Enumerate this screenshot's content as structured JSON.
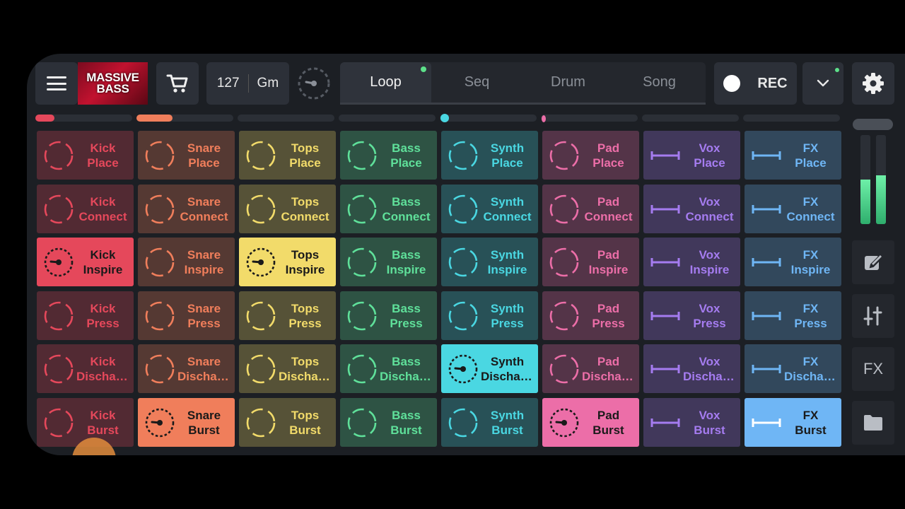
{
  "header": {
    "pack_title_line1": "MASSIVE",
    "pack_title_line2": "BASS",
    "tempo": "127",
    "key": "Gm",
    "tabs": [
      {
        "label": "Loop",
        "active": true
      },
      {
        "label": "Seq",
        "active": false
      },
      {
        "label": "Drum",
        "active": false
      },
      {
        "label": "Song",
        "active": false
      }
    ],
    "rec_label": "REC"
  },
  "side": {
    "fx_label": "FX",
    "volume_levels": [
      0.5,
      0.55
    ]
  },
  "groups": [
    {
      "name": "Kick",
      "color": "#e5485b",
      "progress": 0.2
    },
    {
      "name": "Snare",
      "color": "#f07e5b",
      "progress": 0.37
    },
    {
      "name": "Tops",
      "color": "#f2db6a",
      "progress": 0
    },
    {
      "name": "Bass",
      "color": "#5fe09a",
      "progress": 0
    },
    {
      "name": "Synth",
      "color": "#4ad7e2",
      "progress": 0
    },
    {
      "name": "Pad",
      "color": "#ec6ea8",
      "progress": 0
    },
    {
      "name": "Vox",
      "color": "#a57cf0",
      "progress": 0
    },
    {
      "name": "FX",
      "color": "#6fb6f5",
      "progress": 0
    }
  ],
  "rows": [
    "Place",
    "Connect",
    "Inspire",
    "Press",
    "Dischar...",
    "Burst"
  ],
  "pads": [
    [
      "Kick",
      "Place"
    ],
    [
      "Snare",
      "Place"
    ],
    [
      "Tops",
      "Place"
    ],
    [
      "Bass",
      "Place"
    ],
    [
      "Synth",
      "Place"
    ],
    [
      "Pad",
      "Place"
    ],
    [
      "Vox",
      "Place"
    ],
    [
      "FX",
      "Place"
    ],
    [
      "Kick",
      "Connect"
    ],
    [
      "Snare",
      "Connect"
    ],
    [
      "Tops",
      "Connect"
    ],
    [
      "Bass",
      "Connect"
    ],
    [
      "Synth",
      "Connect"
    ],
    [
      "Pad",
      "Connect"
    ],
    [
      "Vox",
      "Connect"
    ],
    [
      "FX",
      "Connect"
    ],
    [
      "Kick",
      "Inspire"
    ],
    [
      "Snare",
      "Inspire"
    ],
    [
      "Tops",
      "Inspire"
    ],
    [
      "Bass",
      "Inspire"
    ],
    [
      "Synth",
      "Inspire"
    ],
    [
      "Pad",
      "Inspire"
    ],
    [
      "Vox",
      "Inspire"
    ],
    [
      "FX",
      "Inspire"
    ],
    [
      "Kick",
      "Press"
    ],
    [
      "Snare",
      "Press"
    ],
    [
      "Tops",
      "Press"
    ],
    [
      "Bass",
      "Press"
    ],
    [
      "Synth",
      "Press"
    ],
    [
      "Pad",
      "Press"
    ],
    [
      "Vox",
      "Press"
    ],
    [
      "FX",
      "Press"
    ],
    [
      "Kick",
      "Dischar..."
    ],
    [
      "Snare",
      "Dischar..."
    ],
    [
      "Tops",
      "Dischar..."
    ],
    [
      "Bass",
      "Dischar..."
    ],
    [
      "Synth",
      "Dischar..."
    ],
    [
      "Pad",
      "Dischar..."
    ],
    [
      "Vox",
      "Dischar..."
    ],
    [
      "FX",
      "Dischar..."
    ],
    [
      "Kick",
      "Burst"
    ],
    [
      "Snare",
      "Burst"
    ],
    [
      "Tops",
      "Burst"
    ],
    [
      "Bass",
      "Burst"
    ],
    [
      "Synth",
      "Burst"
    ],
    [
      "Pad",
      "Burst"
    ],
    [
      "Vox",
      "Burst"
    ],
    [
      "FX",
      "Burst"
    ]
  ],
  "active_pads": [
    {
      "group": "Kick",
      "row": "Inspire"
    },
    {
      "group": "Tops",
      "row": "Inspire"
    },
    {
      "group": "Synth",
      "row": "Dischar..."
    },
    {
      "group": "Snare",
      "row": "Burst"
    },
    {
      "group": "Pad",
      "row": "Burst"
    },
    {
      "group": "FX",
      "row": "Burst"
    }
  ],
  "icons": {
    "menu": "hamburger-icon",
    "cart": "cart-icon",
    "metronome": "metronome-icon",
    "rec": "record-circle-icon",
    "dropdown": "chevron-down-icon",
    "settings": "gear-icon",
    "edit": "edit-icon",
    "mixer": "sliders-icon",
    "folder": "folder-icon",
    "pad_loop": "dashed-circle-icon",
    "pad_oneshot": "bar-icon"
  }
}
